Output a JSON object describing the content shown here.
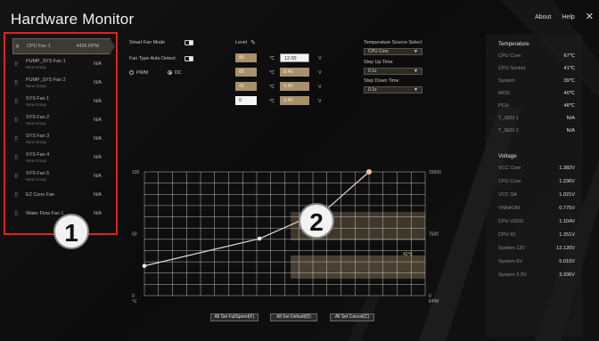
{
  "app": {
    "title": "Hardware Monitor"
  },
  "topbar": {
    "about": "About",
    "help": "Help",
    "close": "✕"
  },
  "fans": [
    {
      "name": "CPU Fan 1",
      "group": "",
      "value": "4426 RPM",
      "active": true
    },
    {
      "name": "PUMP_SYS Fan 1",
      "group": "None Group",
      "value": "N/A"
    },
    {
      "name": "PUMP_SYS Fan 2",
      "group": "None Group",
      "value": "N/A"
    },
    {
      "name": "SYS Fan 1",
      "group": "None Group",
      "value": "N/A"
    },
    {
      "name": "SYS Fan 2",
      "group": "None Group",
      "value": "N/A"
    },
    {
      "name": "SYS Fan 3",
      "group": "None Group",
      "value": "N/A"
    },
    {
      "name": "SYS Fan 4",
      "group": "None Group",
      "value": "N/A"
    },
    {
      "name": "SYS Fan 5",
      "group": "None Group",
      "value": "N/A"
    },
    {
      "name": "EZ Conn Fan",
      "group": "",
      "value": "N/A"
    },
    {
      "name": "Water Flow Fan 1",
      "group": "",
      "value": "N/A"
    }
  ],
  "badges": {
    "one": "1",
    "two": "2"
  },
  "controls": {
    "smart_fan_mode": "Smart Fan Mode",
    "fan_type_auto_detect": "Fan Type Auto Detect",
    "pwm": "PWM",
    "dc": "DC",
    "level": "Level",
    "level_icon": "pencil-icon",
    "levels": [
      {
        "temp": "80",
        "unit": "℃",
        "pct": "12.00",
        "pct_unit": "V",
        "style": "gold",
        "pct_style": "white"
      },
      {
        "temp": "65",
        "unit": "℃",
        "pct": "8.40",
        "pct_unit": "V",
        "style": "gold",
        "pct_style": "gold"
      },
      {
        "temp": "41",
        "unit": "℃",
        "pct": "5.40",
        "pct_unit": "V",
        "style": "gold",
        "pct_style": "gold"
      },
      {
        "temp": "0",
        "unit": "℃",
        "pct": "2.40",
        "pct_unit": "V",
        "style": "white",
        "pct_style": "gold"
      }
    ],
    "temp_source_label": "Temperature Source Select",
    "temp_source_value": "CPU Core",
    "step_up_label": "Step Up Time",
    "step_up_value": "0.1s",
    "step_down_label": "Step Down Time",
    "step_down_value": "0.1s"
  },
  "chart_data": {
    "type": "line",
    "y_left_ticks": [
      "100",
      "50",
      "0"
    ],
    "y_left_unit": "℃",
    "y_right_ticks": [
      "15000",
      "7500",
      "0"
    ],
    "y_right_unit": "RPM",
    "ylim": [
      0,
      100
    ],
    "xlim": [
      0,
      100
    ],
    "curve": [
      {
        "x": 0,
        "y": 24
      },
      {
        "x": 41,
        "y": 46
      },
      {
        "x": 65,
        "y": 70
      },
      {
        "x": 80,
        "y": 100
      }
    ],
    "history_label": "42℃"
  },
  "buttons": {
    "full_speed": "All Set FullSpeed(F)",
    "default": "All Set Default(D)",
    "cancel": "All Set Cancel(C)"
  },
  "temperature": {
    "header": "Temperature",
    "rows": [
      {
        "label": "CPU Core",
        "value": "67℃"
      },
      {
        "label": "CPU Socket",
        "value": "41℃"
      },
      {
        "label": "System",
        "value": "39℃"
      },
      {
        "label": "MOS",
        "value": "40℃"
      },
      {
        "label": "PCH",
        "value": "48℃"
      },
      {
        "label": "T_SEN 1",
        "value": "N/A"
      },
      {
        "label": "T_SEN 2",
        "value": "N/A"
      }
    ]
  },
  "voltage": {
    "header": "Voltage",
    "rows": [
      {
        "label": "VCC Core",
        "value": "1.382V"
      },
      {
        "label": "CPU Core",
        "value": "1.236V"
      },
      {
        "label": "VCC SA",
        "value": "1.021V"
      },
      {
        "label": "VNNAON",
        "value": "0.775V"
      },
      {
        "label": "CPU VDD2",
        "value": "1.104V"
      },
      {
        "label": "CPU IO",
        "value": "1.251V"
      },
      {
        "label": "System 12V",
        "value": "12.120V"
      },
      {
        "label": "System 5V",
        "value": "5.010V"
      },
      {
        "label": "System 3.3V",
        "value": "3.336V"
      }
    ]
  },
  "colors": {
    "accent": "#a8916a",
    "highlight": "#e2231a",
    "point": "#f0c2a8"
  }
}
